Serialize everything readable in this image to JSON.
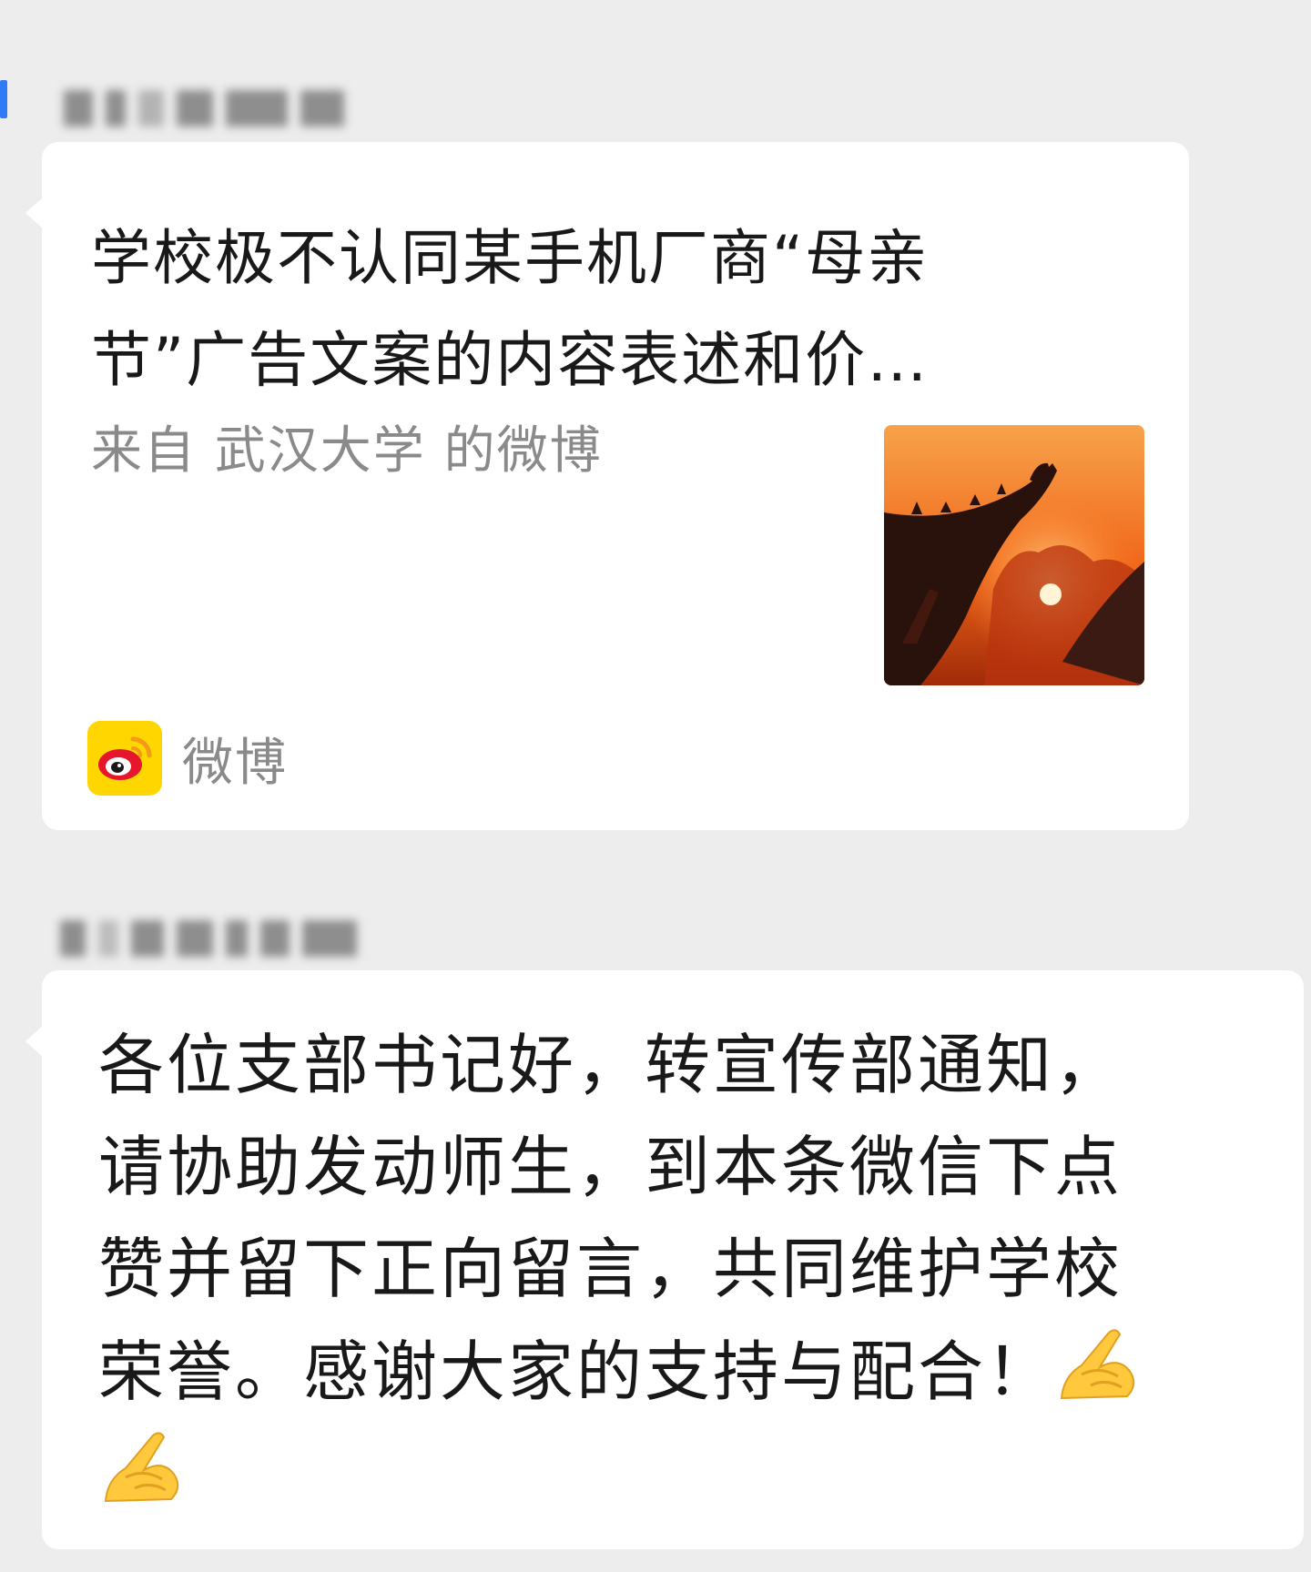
{
  "messages": [
    {
      "type": "link-card",
      "title_lines": [
        "学校极不认同某手机厂商“母亲",
        "节”广告文案的内容表述和价…"
      ],
      "source": "来自 武汉大学 的微博",
      "thumbnail_icon": "sunset-temple-eave-photo",
      "app_icon": "weibo-logo-icon",
      "app_name": "微博"
    },
    {
      "type": "text",
      "lines": [
        "各位支部书记好，转宣传部通知，",
        "请协助发动师生，到本条微信下点",
        "赞并留下正向留言，共同维护学校",
        "荣誉。感谢大家的支持与配合！"
      ],
      "emoji_icon": "folded-hands-icon",
      "emoji_count": 2
    }
  ],
  "colors": {
    "background": "#ededed",
    "bubble": "#ffffff",
    "text": "#191919",
    "secondary_text": "#8a8a8a",
    "weibo_yellow": "#ffd600",
    "weibo_red": "#e6162d"
  }
}
